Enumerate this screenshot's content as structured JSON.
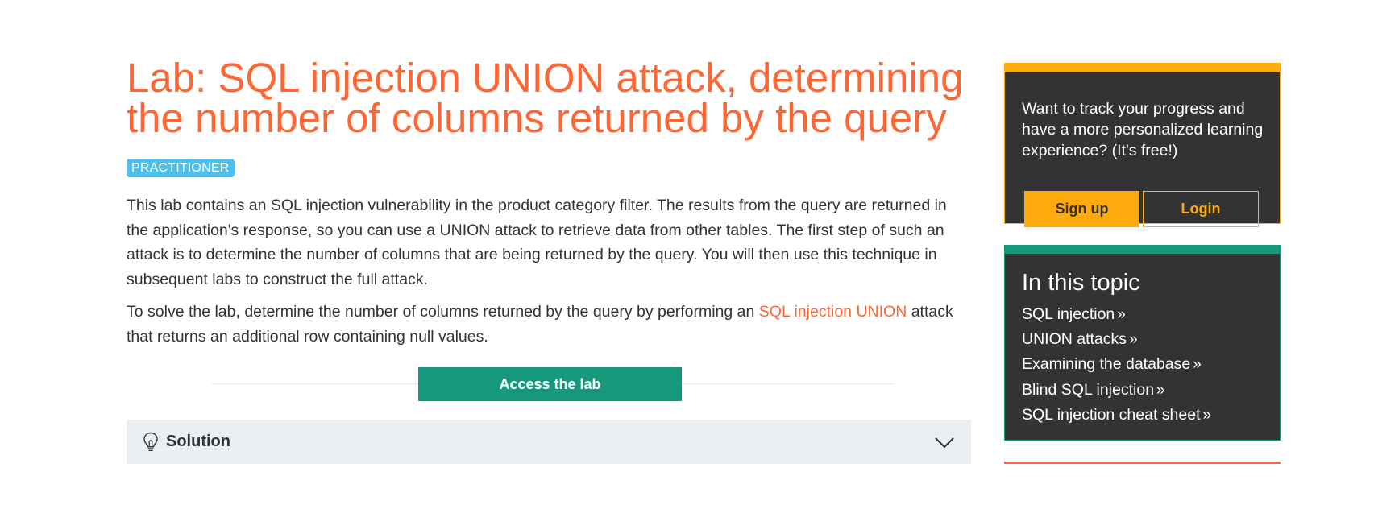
{
  "main": {
    "title": "Lab: SQL injection UNION attack, determining the number of columns returned by the query",
    "level_badge": "PRACTITIONER",
    "description": "This lab contains an SQL injection vulnerability in the product category filter. The results from the query are returned in the application's response, so you can use a UNION attack to retrieve data from other tables. The first step of such an attack is to determine the number of columns that are being returned by the query. You will then use this technique in subsequent labs to construct the full attack.",
    "task_prefix": "To solve the lab, determine the number of columns returned by the query by performing an ",
    "task_link": "SQL injection UNION",
    "task_suffix": " attack that returns an additional row containing null values.",
    "access_button": "Access the lab",
    "solution_label": "Solution"
  },
  "sidebar": {
    "signup_text": "Want to track your progress and have a more personalized learning experience? (It's free!)",
    "signup_button": "Sign up",
    "login_button": "Login",
    "topic_title": "In this topic",
    "topics": [
      "SQL injection",
      "UNION attacks",
      "Examining the database",
      "Blind SQL injection",
      "SQL injection cheat sheet"
    ],
    "topic_arrow": "»"
  },
  "colors": {
    "accent_orange": "#ff6633",
    "badge_blue": "#4cc1f0",
    "green": "#17987c",
    "yellow": "#ffaa0f",
    "dark_panel": "#333333"
  },
  "icons": {
    "solution_icon": "lightbulb-icon",
    "expand_icon": "chevron-down-icon",
    "topic_link_icon": "double-chevron-right-icon"
  }
}
